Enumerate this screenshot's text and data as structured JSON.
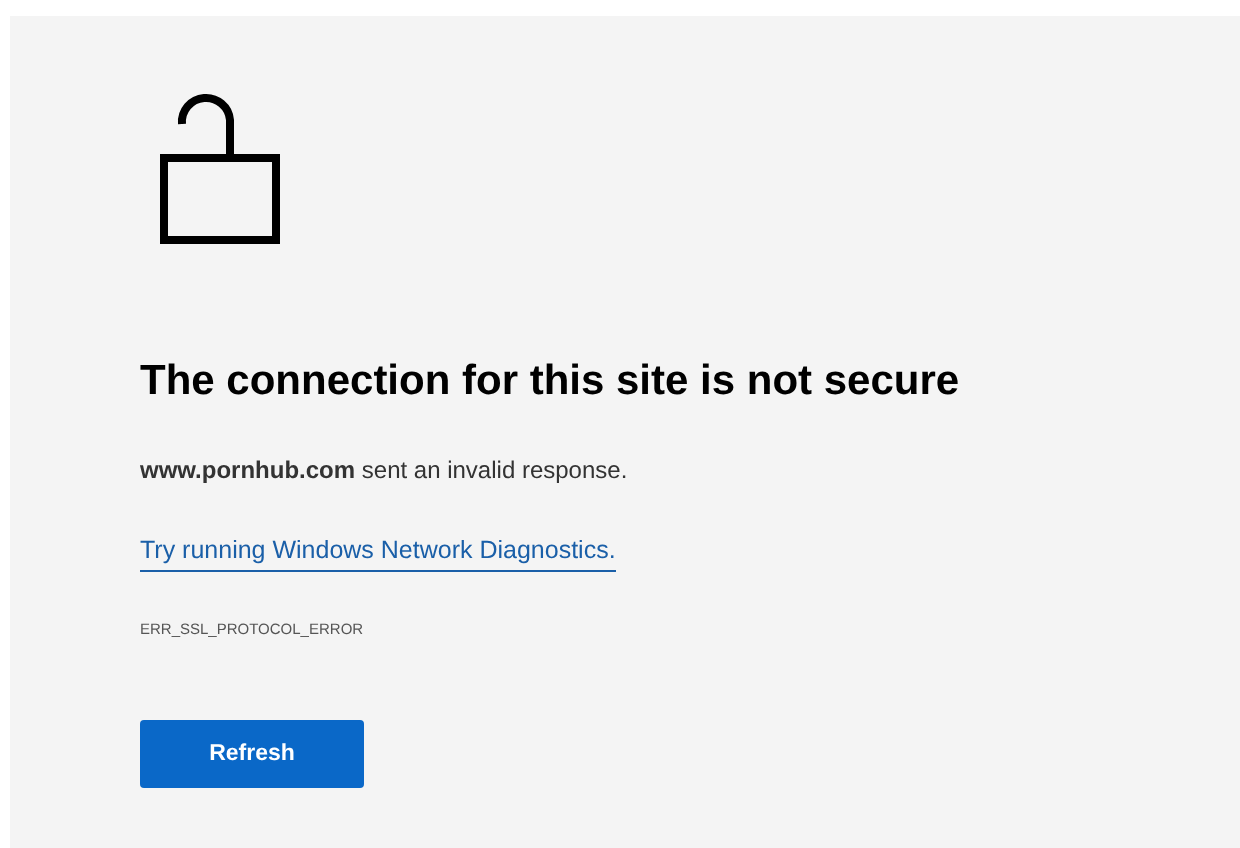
{
  "heading": "The connection for this site is not secure",
  "message": "**www.pornhub.com** sent an invalid response.",
  "link": "Try running Windows Network Diagnostics.",
  "error_code": "ERR_SSL_PROTOCOL_ERROR",
  "button": "Refresh"
}
